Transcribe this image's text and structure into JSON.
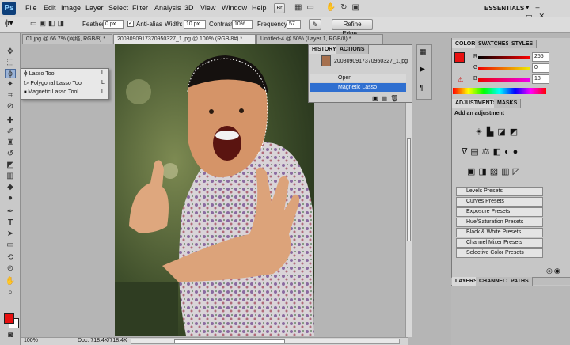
{
  "app": {
    "logo": "Ps",
    "workspace": "ESSENTIALS"
  },
  "menu": [
    "File",
    "Edit",
    "Image",
    "Layer",
    "Select",
    "Filter",
    "Analysis",
    "3D",
    "View",
    "Window",
    "Help"
  ],
  "options": {
    "feather_label": "Feather:",
    "feather_value": "0 px",
    "antialias_label": "Anti-alias",
    "width_label": "Width:",
    "width_value": "10 px",
    "contrast_label": "Contrast:",
    "contrast_value": "10%",
    "frequency_label": "Frequency:",
    "frequency_value": "57",
    "refine_label": "Refine Edge..."
  },
  "tabs": [
    {
      "label": "01.jpg @ 66.7% (网络, RGB/8) *"
    },
    {
      "label": "2008090917370950327_1.jpg @ 100% (RGB/8#) *"
    },
    {
      "label": "Untitled-4 @ 50% (Layer 1, RGB/8) *"
    }
  ],
  "flyout": [
    {
      "label": "Lasso Tool",
      "key": "L"
    },
    {
      "label": "Polygonal Lasso Tool",
      "key": "L"
    },
    {
      "label": "Magnetic Lasso Tool",
      "key": "L"
    }
  ],
  "history": {
    "tab1": "HISTORY",
    "tab2": "ACTIONS",
    "snapshot": "2008090917370950327_1.jpg",
    "items": [
      "Open",
      "Magnetic Lasso"
    ]
  },
  "status": {
    "zoom": "100%",
    "doc": "Doc: 718.4K/718.4K"
  },
  "color": {
    "tabs": [
      "COLOR",
      "SWATCHES",
      "STYLES"
    ],
    "r": "255",
    "g": "0",
    "b": "18",
    "r_label": "R",
    "g_label": "G",
    "b_label": "B",
    "fg": "#e81010"
  },
  "adjustments": {
    "tabs": [
      "ADJUSTMENTS",
      "MASKS"
    ],
    "heading": "Add an adjustment",
    "presets": [
      "Levels Presets",
      "Curves Presets",
      "Exposure Presets",
      "Hue/Saturation Presets",
      "Black & White Presets",
      "Channel Mixer Presets",
      "Selective Color Presets"
    ]
  },
  "layers": {
    "tabs": [
      "LAYERS",
      "CHANNELS",
      "PATHS"
    ]
  }
}
